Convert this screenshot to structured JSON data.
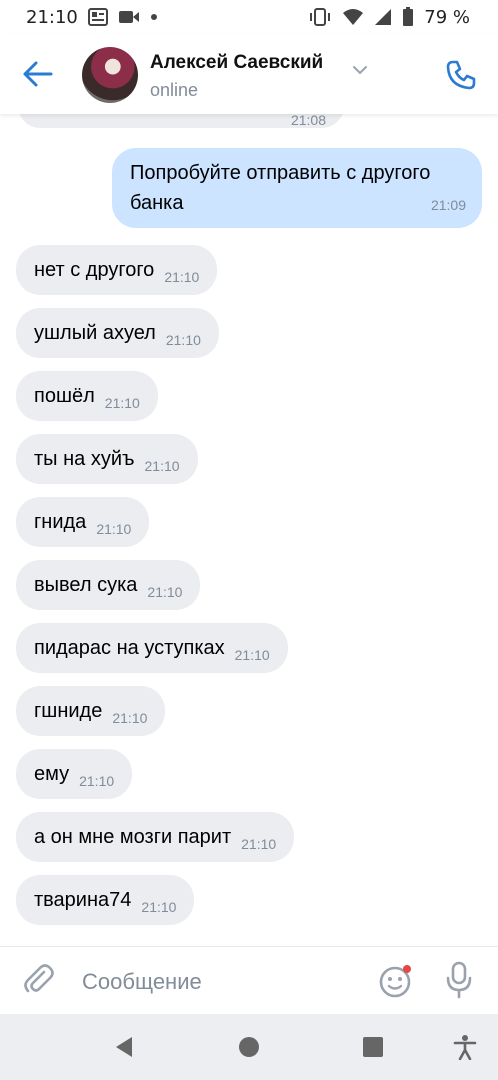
{
  "status_bar": {
    "time": "21:10",
    "battery": "79 %"
  },
  "header": {
    "contact_name": "Алексей Саевский",
    "status": "online",
    "icons": {
      "back": "arrow-left-icon",
      "call": "phone-icon",
      "dropdown": "chevron-down-icon"
    }
  },
  "messages": {
    "cut_top_time": "21:08",
    "outgoing": [
      {
        "text": "Попробуйте отправить с другого банка",
        "time": "21:09"
      }
    ],
    "incoming": [
      {
        "text": "нет с другого",
        "time": "21:10"
      },
      {
        "text": "ушлый ахуел",
        "time": "21:10"
      },
      {
        "text": "пошёл",
        "time": "21:10"
      },
      {
        "text": "ты на хуйъ",
        "time": "21:10"
      },
      {
        "text": "гнида",
        "time": "21:10"
      },
      {
        "text": "вывел сука",
        "time": "21:10"
      },
      {
        "text": "пидарас на уступках",
        "time": "21:10"
      },
      {
        "text": "гшниде",
        "time": "21:10"
      },
      {
        "text": "ему",
        "time": "21:10"
      },
      {
        "text": "а он мне мозги парит",
        "time": "21:10"
      },
      {
        "text": "тварина74",
        "time": "21:10"
      }
    ]
  },
  "composer": {
    "placeholder": "Сообщение"
  },
  "colors": {
    "accent": "#2c7bd2",
    "incoming_bubble": "#ebedf0",
    "outgoing_bubble": "#cce4ff",
    "secondary_text": "#818c99"
  }
}
